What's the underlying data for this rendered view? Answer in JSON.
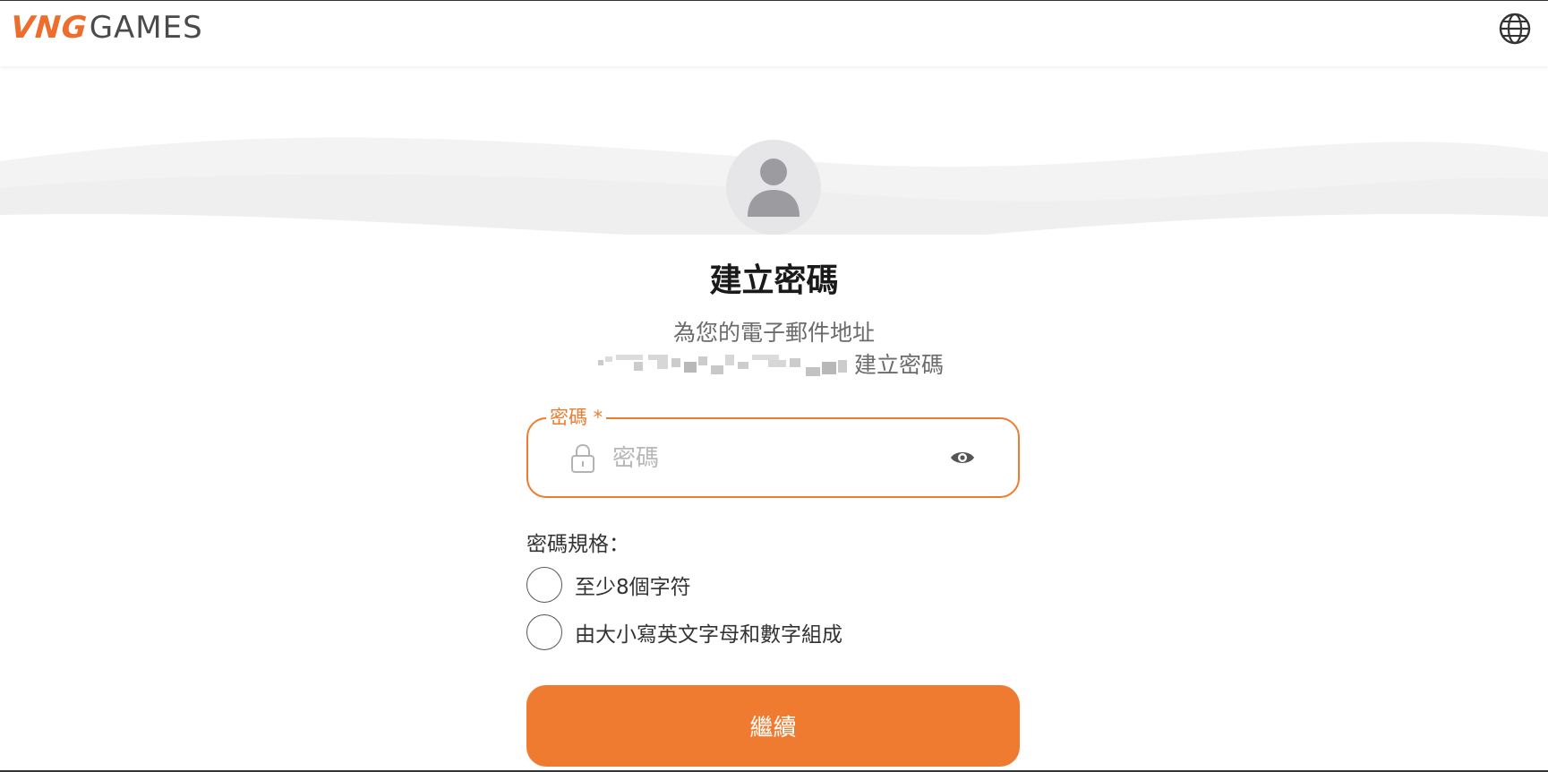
{
  "header": {
    "logo_brand": "VNG",
    "logo_suffix": "GAMES",
    "language_icon": "globe-icon"
  },
  "main": {
    "avatar_icon": "user-avatar-icon",
    "title": "建立密碼",
    "subtitle_line1": "為您的電子郵件地址",
    "subtitle_line2_suffix": "建立密碼"
  },
  "password_field": {
    "label": "密碼 *",
    "placeholder": "密碼",
    "value": "",
    "lock_icon": "lock-icon",
    "toggle_icon": "eye-icon"
  },
  "rules": {
    "title": "密碼規格：",
    "items": [
      {
        "label": "至少8個字符",
        "checked": false
      },
      {
        "label": "由大小寫英文字母和數字組成",
        "checked": false
      }
    ]
  },
  "actions": {
    "continue_label": "繼續"
  },
  "colors": {
    "accent": "#ee7b2f",
    "brand": "#ee6c2c",
    "avatar_bg": "#e6e6e8"
  }
}
